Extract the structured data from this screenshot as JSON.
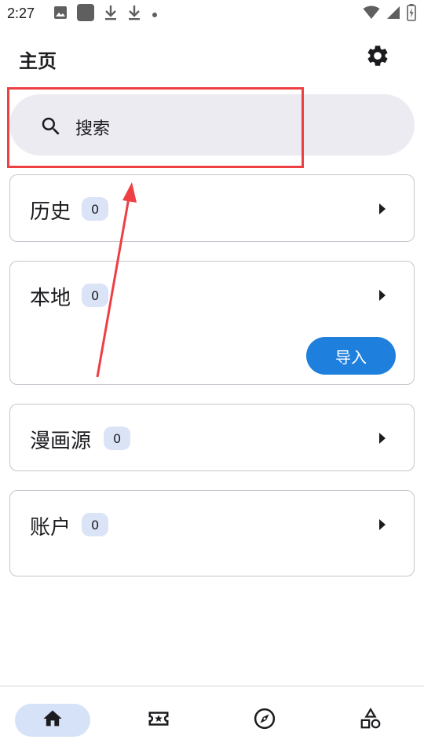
{
  "status_bar": {
    "time": "2:27",
    "left_icons": [
      "image-icon",
      "app-square-icon",
      "download-icon",
      "download-icon",
      "dot-icon"
    ],
    "right_icons": [
      "wifi-icon",
      "signal-icon",
      "battery-icon"
    ]
  },
  "header": {
    "title": "主页",
    "settings_icon": "gear-icon"
  },
  "search": {
    "placeholder": "搜索",
    "icon": "search-icon"
  },
  "cards": {
    "history": {
      "title": "历史",
      "count": "0"
    },
    "local": {
      "title": "本地",
      "count": "0",
      "import_label": "导入"
    },
    "sources": {
      "title": "漫画源",
      "count": "0"
    },
    "account": {
      "title": "账户",
      "count": "0"
    }
  },
  "bottom_nav": {
    "items": [
      {
        "name": "home",
        "icon": "home-icon",
        "active": true
      },
      {
        "name": "favorites",
        "icon": "ticket-star-icon",
        "active": false
      },
      {
        "name": "explore",
        "icon": "compass-icon",
        "active": false
      },
      {
        "name": "categories",
        "icon": "shapes-icon",
        "active": false
      }
    ]
  },
  "annotation": {
    "highlight_color": "#ee3f43",
    "target": "search"
  },
  "colors": {
    "accent": "#1e7fdd",
    "badge_bg": "#dbe4f6",
    "search_bg": "#ecebf1",
    "nav_active_bg": "#d5e2f7"
  }
}
